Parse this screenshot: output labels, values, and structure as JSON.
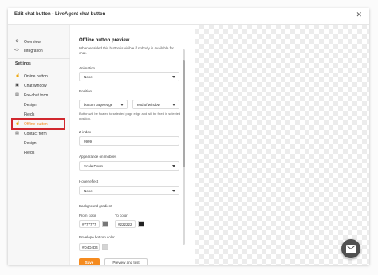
{
  "modal": {
    "title": "Edit chat button - LiveAgent chat button",
    "close_icon": "close-icon"
  },
  "sidebar": {
    "top_items": [
      {
        "label": "Overview",
        "icon": "gear-icon"
      },
      {
        "label": "Integration",
        "icon": "code-icon"
      }
    ],
    "settings_heading": "Settings",
    "settings_items": [
      {
        "label": "Online button",
        "icon": "hand-icon"
      },
      {
        "label": "Chat window",
        "icon": "window-icon"
      },
      {
        "label": "Pre-chat form",
        "icon": "form-icon"
      },
      {
        "label": "Design",
        "icon": ""
      },
      {
        "label": "Fields",
        "icon": ""
      },
      {
        "label": "Offline button",
        "icon": "hand-icon"
      },
      {
        "label": "Contact form",
        "icon": "form-icon"
      },
      {
        "label": "Design",
        "icon": ""
      },
      {
        "label": "Fields",
        "icon": ""
      }
    ]
  },
  "content": {
    "title": "Offline button preview",
    "description": "When enabled this button is visible if nobody is available for chat.",
    "animation": {
      "label": "Animation",
      "value": "None"
    },
    "position": {
      "label": "Position",
      "value1": "bottom page edge",
      "value2": "end of window",
      "help": "Button will be floated to selected page edge and will be fixed in selected position."
    },
    "zindex": {
      "label": "Z-index",
      "value": "9999"
    },
    "appearance_mobiles": {
      "label": "Appearance on mobiles",
      "value": "Scale Down"
    },
    "hover_effect": {
      "label": "Hover effect",
      "value": "None"
    },
    "background_gradient": {
      "label": "Background gradient",
      "from_label": "From color",
      "from_value": "#777777",
      "from_color": "#777777",
      "to_label": "To color",
      "to_value": "#222222",
      "to_color": "#222222"
    },
    "envelope_bottom": {
      "label": "Envelope bottom color",
      "value": "#D4D4D4",
      "color": "#D4D4D4"
    },
    "save_label": "Save",
    "preview_label": "Preview and test"
  },
  "colors": {
    "accent": "#f58b1f",
    "highlight": "#d1282e"
  }
}
